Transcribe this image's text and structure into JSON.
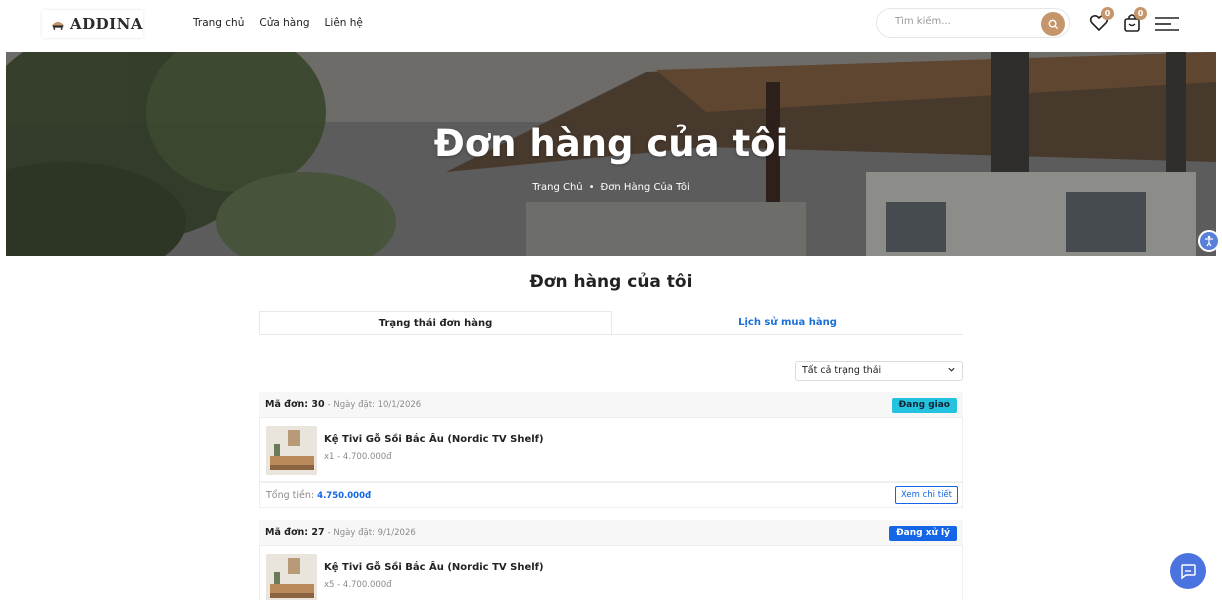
{
  "header": {
    "logo_text": "ADDINA",
    "nav": [
      "Trang chủ",
      "Cửa hàng",
      "Liên hệ"
    ],
    "search_placeholder": "Tìm kiếm...",
    "wishlist_count": "0",
    "cart_count": "0",
    "icons": {
      "search": "search-icon",
      "wishlist": "heart-icon",
      "cart": "bag-icon",
      "menu": "hamburger-menu-icon"
    }
  },
  "hero": {
    "title": "Đơn hàng của tôi",
    "breadcrumb": [
      "Trang Chủ",
      "Đơn Hàng Của Tôi"
    ],
    "separator": "•"
  },
  "main": {
    "title": "Đơn hàng của tôi",
    "tabs": [
      {
        "label": "Trạng thái đơn hàng",
        "active": true
      },
      {
        "label": "Lịch sử mua hàng",
        "active": false
      }
    ],
    "filter": {
      "selected": "Tất cả trạng thái"
    },
    "orders": [
      {
        "id_label": "Mã đơn: 30",
        "date": "- Ngày đặt: 10/1/2026",
        "status": "Đang giao",
        "item_name": "Kệ Tivi Gỗ Sồi Bắc Âu (Nordic TV Shelf)",
        "item_qty": "x1 - 4.700.000đ",
        "total_label": "Tổng tiền:",
        "total_value": "4.750.000đ",
        "detail_button": "Xem chi tiết"
      },
      {
        "id_label": "Mã đơn: 27",
        "date": "- Ngày đặt: 9/1/2026",
        "status": "Đang xử lý",
        "item_name": "Kệ Tivi Gỗ Sồi Bắc Âu (Nordic TV Shelf)",
        "item_qty": "x5 - 4.700.000đ"
      }
    ]
  },
  "colors": {
    "accent": "#c5956b",
    "link": "#1466e6",
    "status_shipping": "#23c3df",
    "status_processing": "#1466e6"
  }
}
